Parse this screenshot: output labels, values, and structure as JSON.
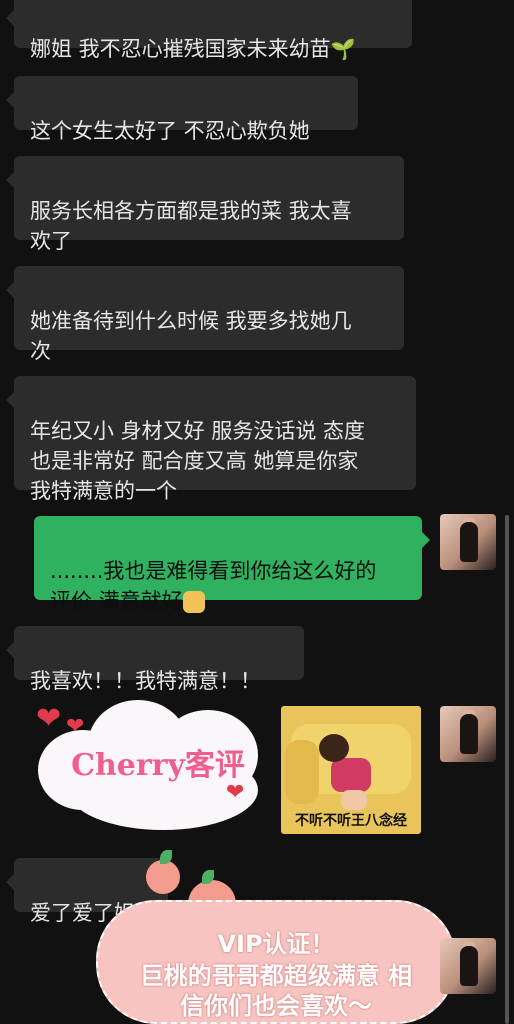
{
  "messages": [
    {
      "text": "娜姐 我不忍心摧残国家未来幼苗"
    },
    {
      "text": "这个女生太好了 不忍心欺负她"
    },
    {
      "text": "服务长相各方面都是我的菜 我太喜\n欢了"
    },
    {
      "text": "她准备待到什么时候 我要多找她几\n次"
    },
    {
      "text": "年纪又小 身材又好 服务没话说 态度\n也是非常好 配合度又高 她算是你家\n我特满意的一个"
    },
    {
      "text": "........我也是难得看到你给这么好的\n评价 满意就好"
    },
    {
      "text": "我喜欢！！我特满意！！"
    },
    {
      "text": "爱了爱了姐"
    }
  ],
  "sticker": {
    "caption": "不听不听王八念经"
  },
  "badge": {
    "text": "Cherry客评"
  },
  "vip": {
    "line1": "VIP认证！",
    "line2": "巨桃的哥哥都超级满意 相",
    "line3": "信你们也会喜欢～"
  },
  "icons": {
    "sprout": "sprout-emoji",
    "doge": "doge-emoji",
    "heart": "heart-icon",
    "peach": "peach-icon"
  },
  "colors": {
    "background": "#111111",
    "incoming": "#2c2c2c",
    "outgoing": "#2fb15f"
  }
}
